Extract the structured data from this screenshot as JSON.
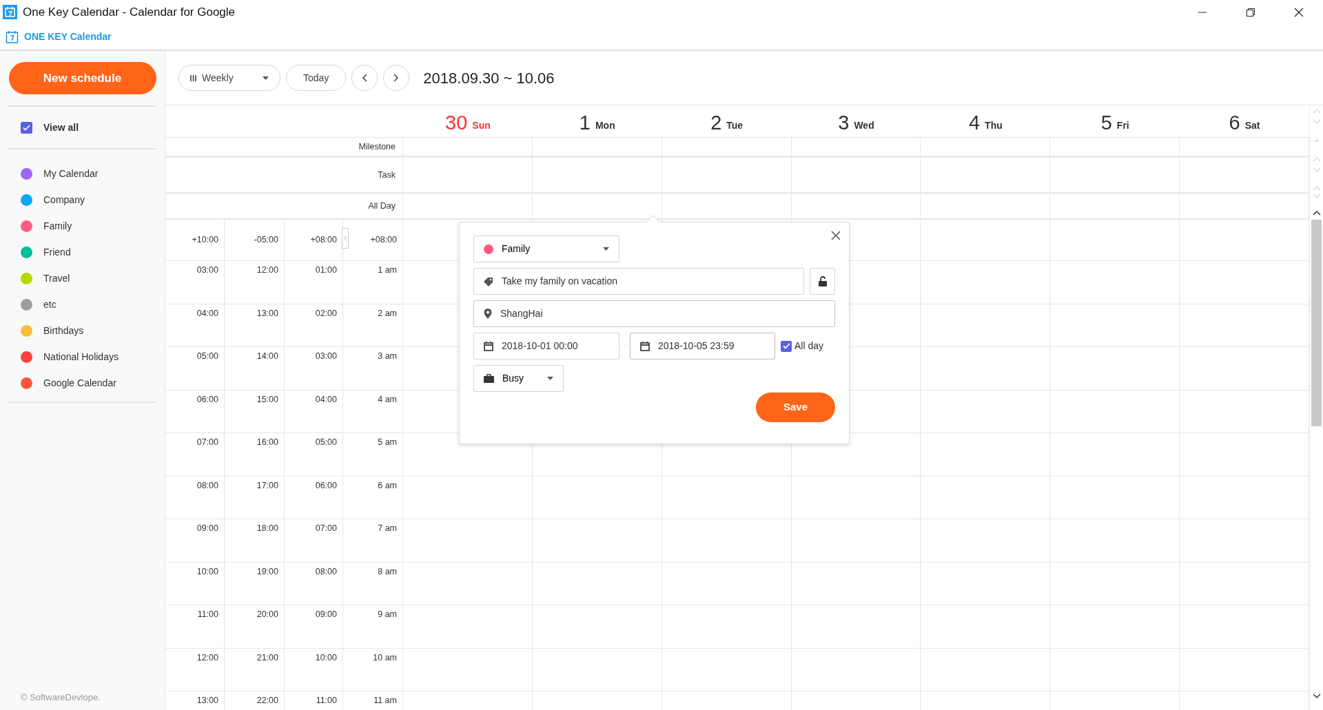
{
  "window": {
    "title": "One Key Calendar - Calendar for Google"
  },
  "app_header": {
    "logo_text": "ONE KEY Calendar"
  },
  "sidebar": {
    "new_button": "New schedule",
    "view_all": {
      "label": "View all",
      "checked": true
    },
    "calendars": [
      {
        "name": "My Calendar",
        "color": "#a066f5"
      },
      {
        "name": "Company",
        "color": "#08a8f4"
      },
      {
        "name": "Family",
        "color": "#ff5b82"
      },
      {
        "name": "Friend",
        "color": "#00bf9a"
      },
      {
        "name": "Travel",
        "color": "#b5d900"
      },
      {
        "name": "etc",
        "color": "#9e9e9e"
      },
      {
        "name": "Birthdays",
        "color": "#ffbb3b"
      },
      {
        "name": "National Holidays",
        "color": "#ff4040"
      },
      {
        "name": "Google Calendar",
        "color": "#ff5540"
      }
    ],
    "footer": "© SoftwareDevlope."
  },
  "toolbar": {
    "view_select": "Weekly",
    "today_button": "Today",
    "date_range": "2018.09.30 ~ 10.06"
  },
  "days": [
    {
      "number": "30",
      "name": "Sun",
      "today": true
    },
    {
      "number": "1",
      "name": "Mon",
      "today": false
    },
    {
      "number": "2",
      "name": "Tue",
      "today": false
    },
    {
      "number": "3",
      "name": "Wed",
      "today": false
    },
    {
      "number": "4",
      "name": "Thu",
      "today": false
    },
    {
      "number": "5",
      "name": "Fri",
      "today": false
    },
    {
      "number": "6",
      "name": "Sat",
      "today": false
    }
  ],
  "all_day_rows": [
    "Milestone",
    "Task",
    "All Day"
  ],
  "timezones": [
    "+10:00",
    "-05:00",
    "+08:00",
    "+08:00"
  ],
  "hours": [
    [
      "03:00",
      "12:00",
      "01:00",
      "1 am"
    ],
    [
      "04:00",
      "13:00",
      "02:00",
      "2 am"
    ],
    [
      "05:00",
      "14:00",
      "03:00",
      "3 am"
    ],
    [
      "06:00",
      "15:00",
      "04:00",
      "4 am"
    ],
    [
      "07:00",
      "16:00",
      "05:00",
      "5 am"
    ],
    [
      "08:00",
      "17:00",
      "06:00",
      "6 am"
    ],
    [
      "09:00",
      "18:00",
      "07:00",
      "7 am"
    ],
    [
      "10:00",
      "19:00",
      "08:00",
      "8 am"
    ],
    [
      "11:00",
      "20:00",
      "09:00",
      "9 am"
    ],
    [
      "12:00",
      "21:00",
      "10:00",
      "10 am"
    ],
    [
      "13:00",
      "22:00",
      "11:00",
      "11 am"
    ]
  ],
  "popup": {
    "calendar": {
      "name": "Family",
      "color": "#ff5b82"
    },
    "title_value": "Take my family on vacation",
    "location_value": "ShangHai",
    "start": "2018-10-01 00:00",
    "end": "2018-10-05 23:59",
    "all_day": {
      "label": "All day",
      "checked": true
    },
    "availability": "Busy",
    "save_button": "Save"
  }
}
